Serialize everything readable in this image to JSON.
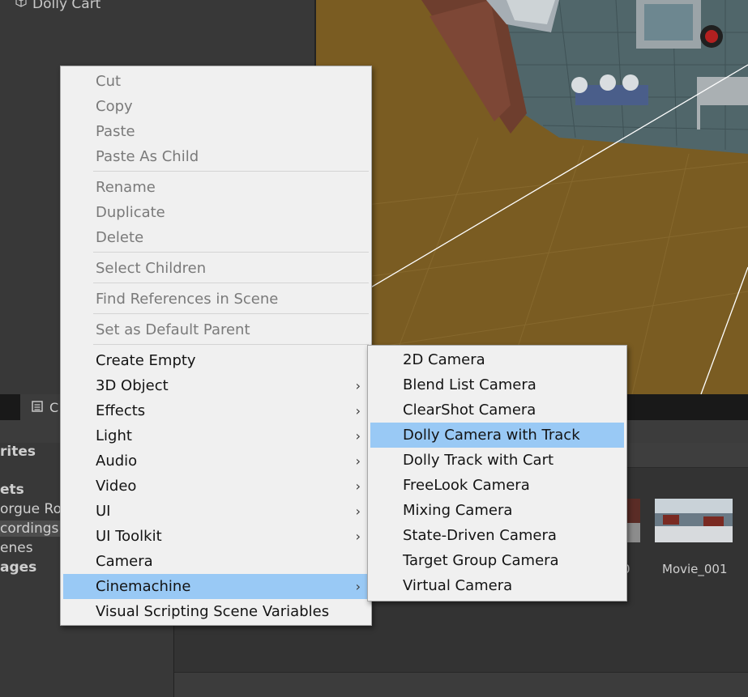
{
  "hierarchy": {
    "item_label": "Dolly Cart"
  },
  "dock": {
    "tab_label": "C",
    "tree": {
      "favorites": "rites",
      "assets": "ets",
      "item1": "orgue Roo",
      "item2": "cordings",
      "item3": "enes",
      "packages": "ages"
    },
    "assets": [
      {
        "label": "0"
      },
      {
        "label": "Movie_001"
      }
    ]
  },
  "context_menu": {
    "items": [
      {
        "label": "Cut",
        "disabled": true
      },
      {
        "label": "Copy",
        "disabled": true
      },
      {
        "label": "Paste",
        "disabled": true
      },
      {
        "label": "Paste As Child",
        "disabled": true
      },
      {
        "label": "Rename",
        "disabled": true
      },
      {
        "label": "Duplicate",
        "disabled": true
      },
      {
        "label": "Delete",
        "disabled": true
      },
      {
        "label": "Select Children",
        "disabled": true
      },
      {
        "label": "Find References in Scene",
        "disabled": true
      },
      {
        "label": "Set as Default Parent",
        "disabled": true
      },
      {
        "label": "Create Empty"
      },
      {
        "label": "3D Object",
        "submenu": true
      },
      {
        "label": "Effects",
        "submenu": true
      },
      {
        "label": "Light",
        "submenu": true
      },
      {
        "label": "Audio",
        "submenu": true
      },
      {
        "label": "Video",
        "submenu": true
      },
      {
        "label": "UI",
        "submenu": true
      },
      {
        "label": "UI Toolkit",
        "submenu": true
      },
      {
        "label": "Camera"
      },
      {
        "label": "Cinemachine",
        "submenu": true,
        "highlighted": true
      },
      {
        "label": "Visual Scripting Scene Variables"
      }
    ]
  },
  "cinemachine_submenu": {
    "items": [
      {
        "label": "2D Camera"
      },
      {
        "label": "Blend List Camera"
      },
      {
        "label": "ClearShot Camera"
      },
      {
        "label": "Dolly Camera with Track",
        "highlighted": true
      },
      {
        "label": "Dolly Track with Cart"
      },
      {
        "label": "FreeLook Camera"
      },
      {
        "label": "Mixing Camera"
      },
      {
        "label": "State-Driven Camera"
      },
      {
        "label": "Target Group Camera"
      },
      {
        "label": "Virtual Camera"
      }
    ]
  },
  "colors": {
    "menu_bg": "#f0f0f0",
    "highlight": "#99c9f5",
    "disabled_text": "#7a7a7a",
    "floor": "#7a5c22"
  }
}
